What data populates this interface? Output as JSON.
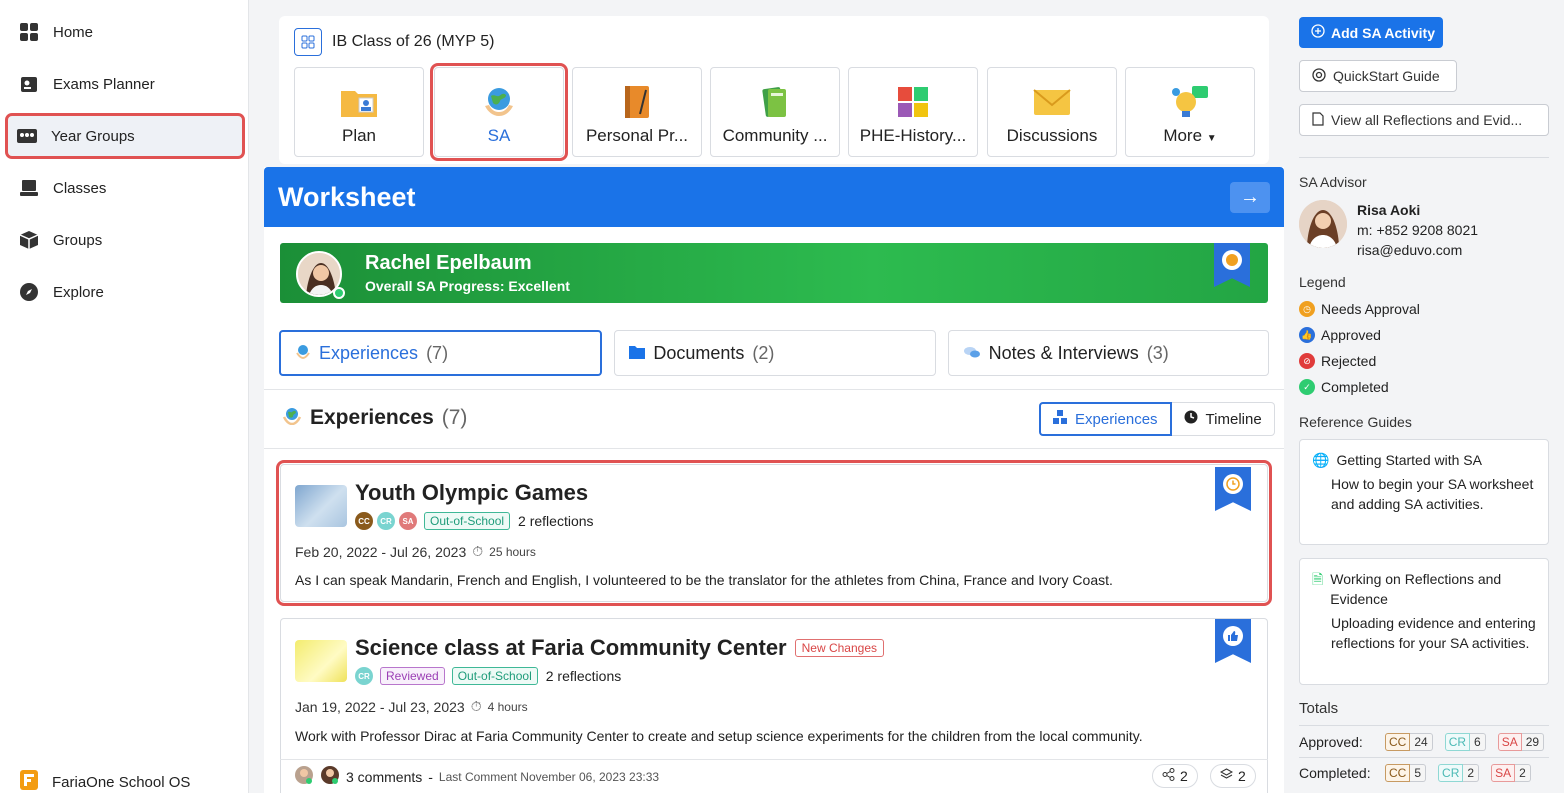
{
  "sidebar": {
    "items": [
      {
        "label": "Home",
        "icon": "dashboard-icon"
      },
      {
        "label": "Exams Planner",
        "icon": "exams-icon"
      },
      {
        "label": "Year Groups",
        "icon": "year-groups-icon"
      },
      {
        "label": "Classes",
        "icon": "classes-icon"
      },
      {
        "label": "Groups",
        "icon": "groups-icon"
      },
      {
        "label": "Explore",
        "icon": "compass-icon"
      }
    ],
    "brand": "FariaOne School OS"
  },
  "class_card": {
    "title": "IB Class of 26 (MYP 5)",
    "tiles": [
      {
        "label": "Plan"
      },
      {
        "label": "SA"
      },
      {
        "label": "Personal Pr..."
      },
      {
        "label": "Community ..."
      },
      {
        "label": "PHE-History..."
      },
      {
        "label": "Discussions"
      },
      {
        "label": "More"
      }
    ]
  },
  "worksheet": {
    "title": "Worksheet",
    "student": {
      "name": "Rachel Epelbaum",
      "progress": "Overall SA Progress: Excellent"
    },
    "tabs": [
      {
        "label": "Experiences",
        "count": "(7)"
      },
      {
        "label": "Documents",
        "count": "(2)"
      },
      {
        "label": "Notes & Interviews",
        "count": "(3)"
      }
    ],
    "section_title": "Experiences",
    "section_count": "(7)",
    "view_toggle": {
      "experiences": "Experiences",
      "timeline": "Timeline"
    },
    "experiences": [
      {
        "title": "Youth Olympic Games",
        "chips": [
          "CC",
          "CR",
          "SA"
        ],
        "tags": [
          "Out-of-School"
        ],
        "reflections": "2 reflections",
        "dates": "Feb 20, 2022 - Jul 26, 2023",
        "hours": "25 hours",
        "description": "As I can speak Mandarin, French and English, I volunteered to be the translator for the athletes from China, France and Ivory Coast."
      },
      {
        "title": "Science class at Faria Community Center",
        "badge": "New Changes",
        "chips": [
          "CR"
        ],
        "tags": [
          "Reviewed",
          "Out-of-School"
        ],
        "reflections": "2 reflections",
        "dates": "Jan 19, 2022 - Jul 23, 2023",
        "hours": "4 hours",
        "description": "Work with Professor Dirac at Faria Community Center to create and setup science experiments for the children from the local community."
      }
    ],
    "comments": {
      "count": "3 comments",
      "separator": "-",
      "last": "Last Comment November 06, 2023 23:33",
      "shares": "2",
      "layers": "2"
    }
  },
  "right_panel": {
    "add_button": "Add SA Activity",
    "quickstart": "QuickStart Guide",
    "view_all": "View all Reflections and Evid...",
    "advisor_label": "SA Advisor",
    "advisor": {
      "name": "Risa Aoki",
      "phone": "m: +852 9208 8021",
      "email": "risa@eduvo.com"
    },
    "legend_label": "Legend",
    "legend": [
      {
        "label": "Needs Approval",
        "color": "#f0a020"
      },
      {
        "label": "Approved",
        "color": "#2a6fdb"
      },
      {
        "label": "Rejected",
        "color": "#e03b3b"
      },
      {
        "label": "Completed",
        "color": "#2ecc71"
      }
    ],
    "guides_label": "Reference Guides",
    "guides": [
      {
        "title": "Getting Started with SA",
        "desc": "How to begin your SA worksheet and adding SA activities."
      },
      {
        "title": "Working on Reflections and Evidence",
        "desc": "Uploading evidence and entering reflections for your SA activities."
      }
    ],
    "totals_label": "Totals",
    "totals": [
      {
        "label": "Approved:",
        "cc": "24",
        "cr": "6",
        "sa": "29"
      },
      {
        "label": "Completed:",
        "cc": "5",
        "cr": "2",
        "sa": "2"
      }
    ],
    "badge_keys": {
      "cc": "CC",
      "cr": "CR",
      "sa": "SA"
    }
  },
  "colors": {
    "accent": "#1a73e8",
    "highlight": "#e05252",
    "progress_green": "#2dbb4f"
  }
}
